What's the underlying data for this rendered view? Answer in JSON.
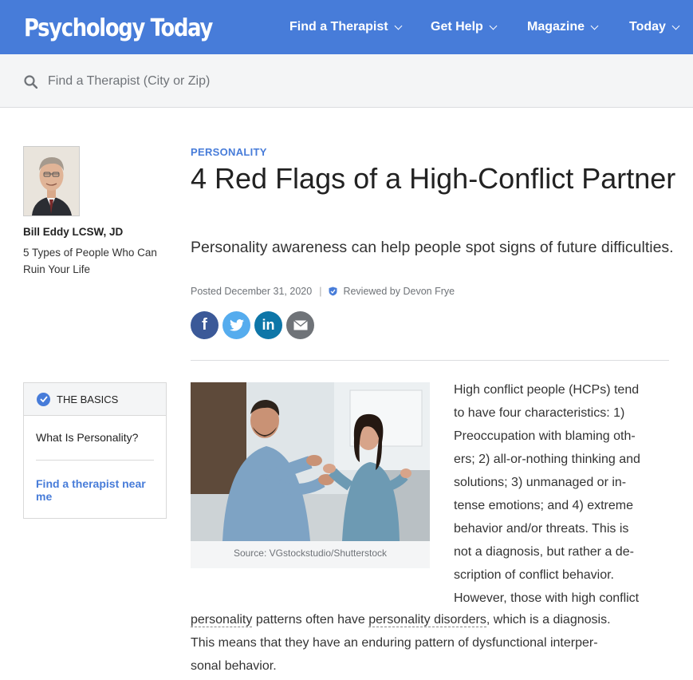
{
  "header": {
    "logo_text": "Psychology Today",
    "nav": [
      "Find a Therapist",
      "Get Help",
      "Magazine",
      "Today"
    ]
  },
  "search": {
    "placeholder": "Find a Therapist (City or Zip)",
    "icon": "search-icon"
  },
  "author": {
    "name": "Bill Eddy LCSW, JD",
    "book": "5 Types of People Who Can Ruin Your Life"
  },
  "basics": {
    "title": "The Basics",
    "item": "What Is Personality?",
    "link": "Find a therapist near me"
  },
  "article": {
    "category": "Personality",
    "title": "4 Red Flags of a High-Conflict Partner",
    "subtitle": "Personality awareness can help people spot signs of future difficulties.",
    "posted": "Posted December 31, 2020",
    "reviewed": "Reviewed by Devon Frye",
    "share_icons": [
      "facebook-icon",
      "twitter-icon",
      "linkedin-icon",
      "email-icon"
    ],
    "image_caption": "Source: VGstockstudio/Shutterstock",
    "body_lines_col": [
      "High conflict people (HCPs) tend",
      "to have four characteristics: 1)",
      "Preoccupation with blaming oth-",
      "ers; 2) all-or-nothing thinking and",
      "solutions; 3) unmanaged or in-",
      "tense emotions; and 4) extreme",
      "behavior and/or threats. This is",
      "not a diagnosis, but rather a de-",
      "scription of conflict behavior.",
      "However, those with high conflict"
    ],
    "body_full": {
      "term1": "personality",
      "mid1": " patterns often have ",
      "term2": "personality disorders",
      "end1": ", which is a diagnosis.",
      "line2": "This means that they have an enduring pattern of dysfunctional interper-",
      "line3": "sonal behavior."
    }
  },
  "colors": {
    "brand": "#477cd9",
    "facebook": "#3b5998",
    "twitter": "#55acee",
    "linkedin": "#0e76a8",
    "email": "#6f7378"
  }
}
